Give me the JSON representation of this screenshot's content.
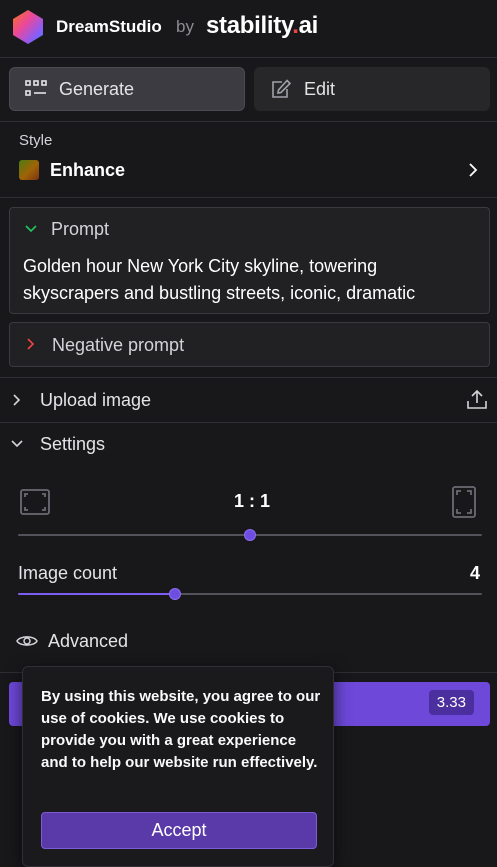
{
  "header": {
    "app_name": "DreamStudio",
    "by": "by",
    "company": "stability",
    "company_dot": ".",
    "company_ai": "ai"
  },
  "tabs": [
    {
      "label": "Generate",
      "icon": "grid-icon",
      "active": true
    },
    {
      "label": "Edit",
      "icon": "edit-icon",
      "active": false
    }
  ],
  "style": {
    "heading": "Style",
    "value": "Enhance"
  },
  "prompt": {
    "heading": "Prompt",
    "text_line1": "Golden hour New York City skyline, towering",
    "text_line2": "skyscrapers and bustling streets, iconic, dramatic"
  },
  "negative_prompt": {
    "heading": "Negative prompt"
  },
  "upload": {
    "label": "Upload image"
  },
  "settings": {
    "label": "Settings",
    "aspect_ratio": "1 : 1",
    "aspect_ratio_position": 0.5,
    "image_count_label": "Image count",
    "image_count_value": "4",
    "image_count_position": 0.338,
    "advanced_label": "Advanced"
  },
  "generate": {
    "credits": "3.33"
  },
  "cookie_banner": {
    "text": "By using this website, you agree to our use of cookies. We use cookies to provide you with a great experience and to help our website run effectively.",
    "accept_label": "Accept"
  }
}
